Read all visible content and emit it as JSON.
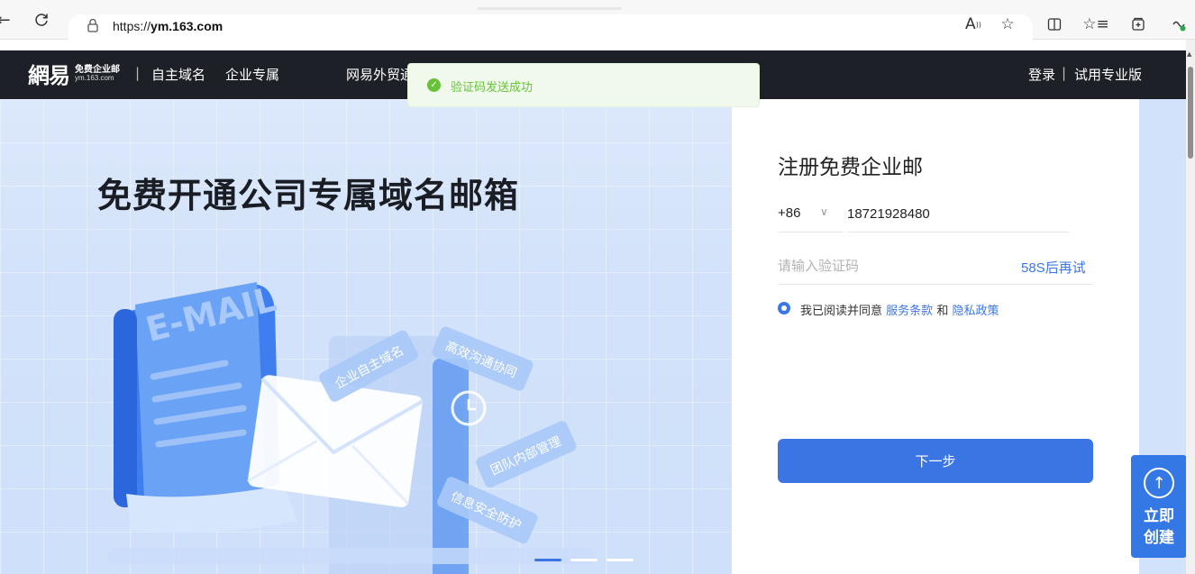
{
  "browser": {
    "url_prefix": "https://",
    "url_domain": "ym.163.com",
    "icons": [
      "back-icon",
      "refresh-icon",
      "lock-icon",
      "read-aloud-icon",
      "favorite-star-icon",
      "split-screen-icon",
      "favorites-list-icon",
      "collections-icon",
      "extension-icon"
    ]
  },
  "header": {
    "logo_main": "網易",
    "logo_sub1": "免费企业邮",
    "logo_sub2": "ym.163.com",
    "divider": "|",
    "nav": [
      "自主域名",
      "企业专属",
      "网易外贸通"
    ],
    "login": "登录",
    "trial": "试用专业版"
  },
  "toast": {
    "message": "验证码发送成功"
  },
  "hero": {
    "title": "免费开通公司专属域名邮箱",
    "art_labels": [
      "E-MAIL",
      "企业自主域名",
      "高效沟通协同",
      "团队内部管理",
      "信息安全防护"
    ]
  },
  "register": {
    "title": "注册免费企业邮",
    "country_code": "+86",
    "phone_value": "18721928480",
    "code_placeholder": "请输入验证码",
    "retry_label": "58S后再试",
    "agree_prefix": "我已阅读并同意",
    "terms_link": "服务条款",
    "and": "和",
    "privacy_link": "隐私政策",
    "next_button": "下一步"
  },
  "float_create": {
    "label": "立即创建"
  },
  "colors": {
    "header_bg": "#1d2127",
    "accent": "#3b74e3",
    "toast_green": "#67c23a",
    "hero_bg": "#d2e2fa"
  }
}
